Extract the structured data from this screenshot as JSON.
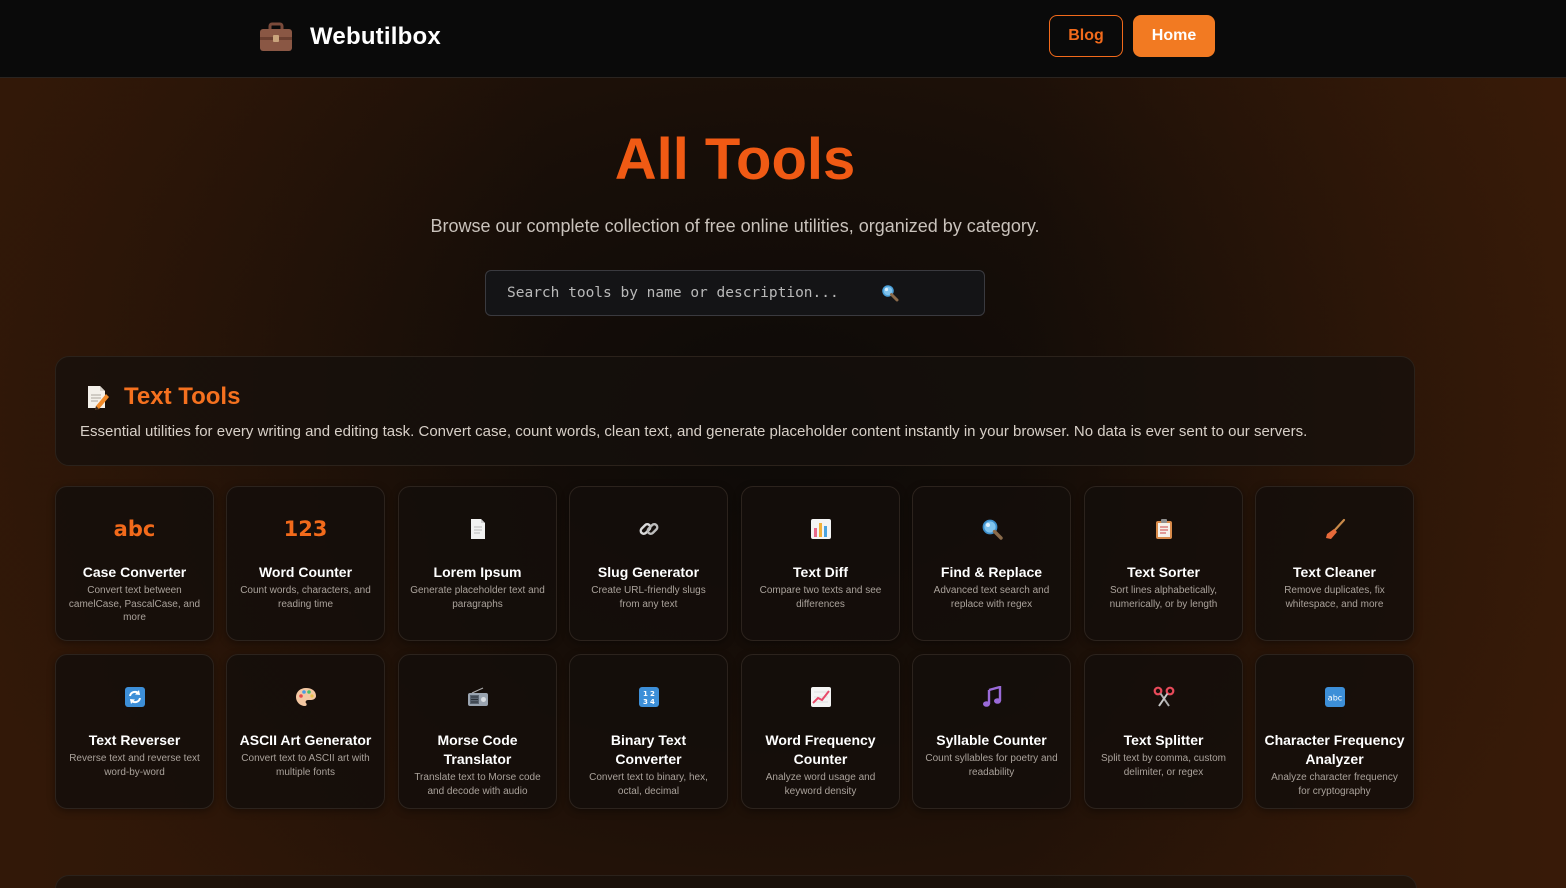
{
  "nav": {
    "brand": "Webutilbox",
    "brand_icon": "briefcase-icon",
    "blog_label": "Blog",
    "home_label": "Home"
  },
  "hero": {
    "title": "All Tools",
    "subtitle": "Browse our complete collection of free online utilities, organized by category.",
    "search_placeholder": "Search tools by name or description...",
    "search_icon": "magnifier-icon"
  },
  "category": {
    "icon": "memo-icon",
    "title": "Text Tools",
    "description": "Essential utilities for every writing and editing task. Convert case, count words, clean text, and generate placeholder content instantly in your browser. No data is ever sent to our servers."
  },
  "colors": {
    "accent": "#f26a1b",
    "title": "#f05a14"
  },
  "tools": [
    {
      "icon": "abc",
      "icon_type": "text",
      "name": "Case Converter",
      "desc": "Convert text between camelCase, PascalCase, and more"
    },
    {
      "icon": "123",
      "icon_type": "text",
      "name": "Word Counter",
      "desc": "Count words, characters, and reading time"
    },
    {
      "icon": "page-icon",
      "icon_type": "svg",
      "name": "Lorem Ipsum",
      "desc": "Generate placeholder text and paragraphs"
    },
    {
      "icon": "link-icon",
      "icon_type": "svg",
      "name": "Slug Generator",
      "desc": "Create URL-friendly slugs from any text"
    },
    {
      "icon": "bar-chart-icon",
      "icon_type": "svg",
      "name": "Text Diff",
      "desc": "Compare two texts and see differences"
    },
    {
      "icon": "magnifier-icon",
      "icon_type": "svg",
      "name": "Find & Replace",
      "desc": "Advanced text search and replace with regex"
    },
    {
      "icon": "clipboard-icon",
      "icon_type": "svg",
      "name": "Text Sorter",
      "desc": "Sort lines alphabetically, numerically, or by length"
    },
    {
      "icon": "broom-icon",
      "icon_type": "svg",
      "name": "Text Cleaner",
      "desc": "Remove duplicates, fix whitespace, and more"
    },
    {
      "icon": "reverse-arrows-icon",
      "icon_type": "svg",
      "name": "Text Reverser",
      "desc": "Reverse text and reverse text word-by-word"
    },
    {
      "icon": "palette-icon",
      "icon_type": "svg",
      "name": "ASCII Art Generator",
      "desc": "Convert text to ASCII art with multiple fonts"
    },
    {
      "icon": "radio-icon",
      "icon_type": "svg",
      "name": "Morse Code Translator",
      "desc": "Translate text to Morse code and decode with audio"
    },
    {
      "icon": "numbers-icon",
      "icon_type": "svg",
      "name": "Binary Text Converter",
      "desc": "Convert text to binary, hex, octal, decimal"
    },
    {
      "icon": "trend-chart-icon",
      "icon_type": "svg",
      "name": "Word Frequency Counter",
      "desc": "Analyze word usage and keyword density"
    },
    {
      "icon": "music-note-icon",
      "icon_type": "svg",
      "name": "Syllable Counter",
      "desc": "Count syllables for poetry and readability"
    },
    {
      "icon": "scissors-icon",
      "icon_type": "svg",
      "name": "Text Splitter",
      "desc": "Split text by comma, custom delimiter, or regex"
    },
    {
      "icon": "abc-box-icon",
      "icon_type": "svg",
      "name": "Character Frequency Analyzer",
      "desc": "Analyze character frequency for cryptography"
    }
  ]
}
